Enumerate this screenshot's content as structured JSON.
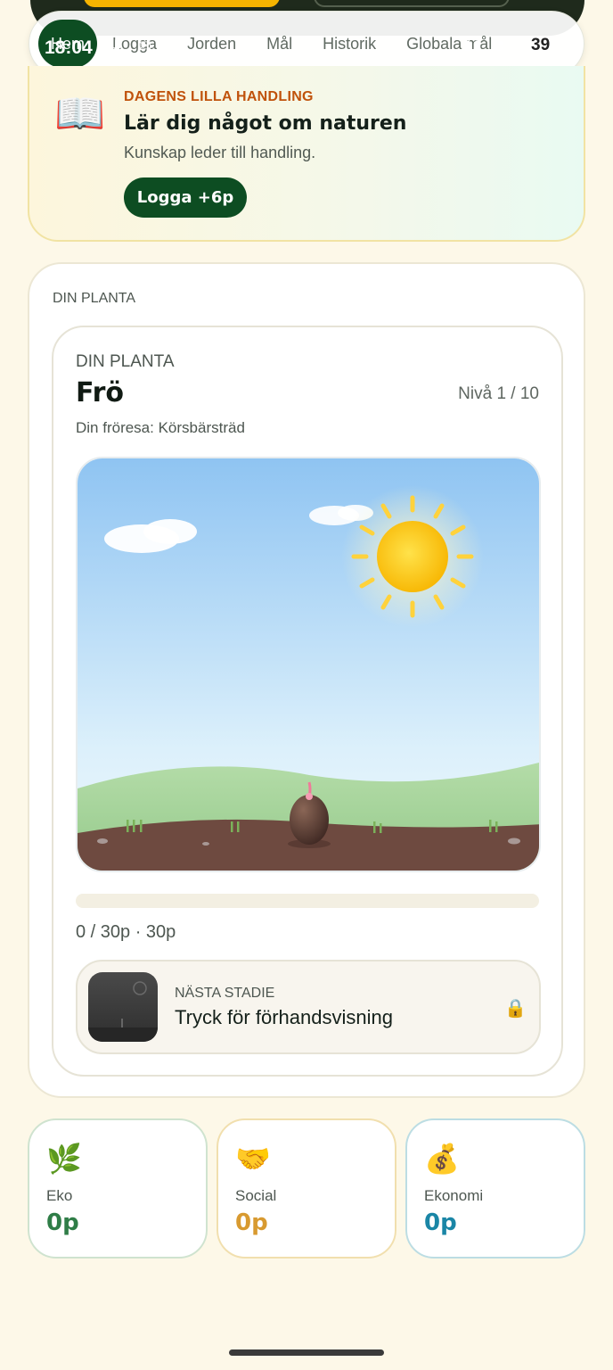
{
  "status_bar": {
    "time": "18:04",
    "battery": "39"
  },
  "nav": {
    "items": [
      {
        "label": "Hem",
        "active": true
      },
      {
        "label": "Logga",
        "active": false
      },
      {
        "label": "Jorden",
        "active": false
      },
      {
        "label": "Mål",
        "active": false
      },
      {
        "label": "Historik",
        "active": false
      },
      {
        "label": "Globala mål",
        "active": false
      }
    ]
  },
  "daily": {
    "icon": "book-icon",
    "tag": "DAGENS LILLA HANDLING",
    "title": "Lär dig något om naturen",
    "subtitle": "Kunskap leder till handling.",
    "button": "Logga +6p"
  },
  "plant": {
    "section_label": "DIN PLANTA",
    "card_label": "DIN PLANTA",
    "stage": "Frö",
    "level": "Nivå 1 / 10",
    "journey": "Din fröresa: Körsbärsträd",
    "progress_fraction": 0,
    "progress_text": "0 / 30p · 30p",
    "next_stage_label": "NÄSTA STADIE",
    "next_stage_action": "Tryck för förhandsvisning"
  },
  "scores": [
    {
      "icon": "🌿",
      "name": "Eko",
      "value": "0p",
      "color": "#2f7d47",
      "border": "#cfe3cf"
    },
    {
      "icon": "🤝",
      "name": "Social",
      "value": "0p",
      "color": "#d89a30",
      "border": "#f1dfae"
    },
    {
      "icon": "💰",
      "name": "Ekonomi",
      "value": "0p",
      "color": "#1a86a6",
      "border": "#bcdde3"
    }
  ],
  "colors": {
    "primary": "#0d4d22",
    "accent_orange": "#c0520b",
    "background": "#fdf8e8"
  }
}
